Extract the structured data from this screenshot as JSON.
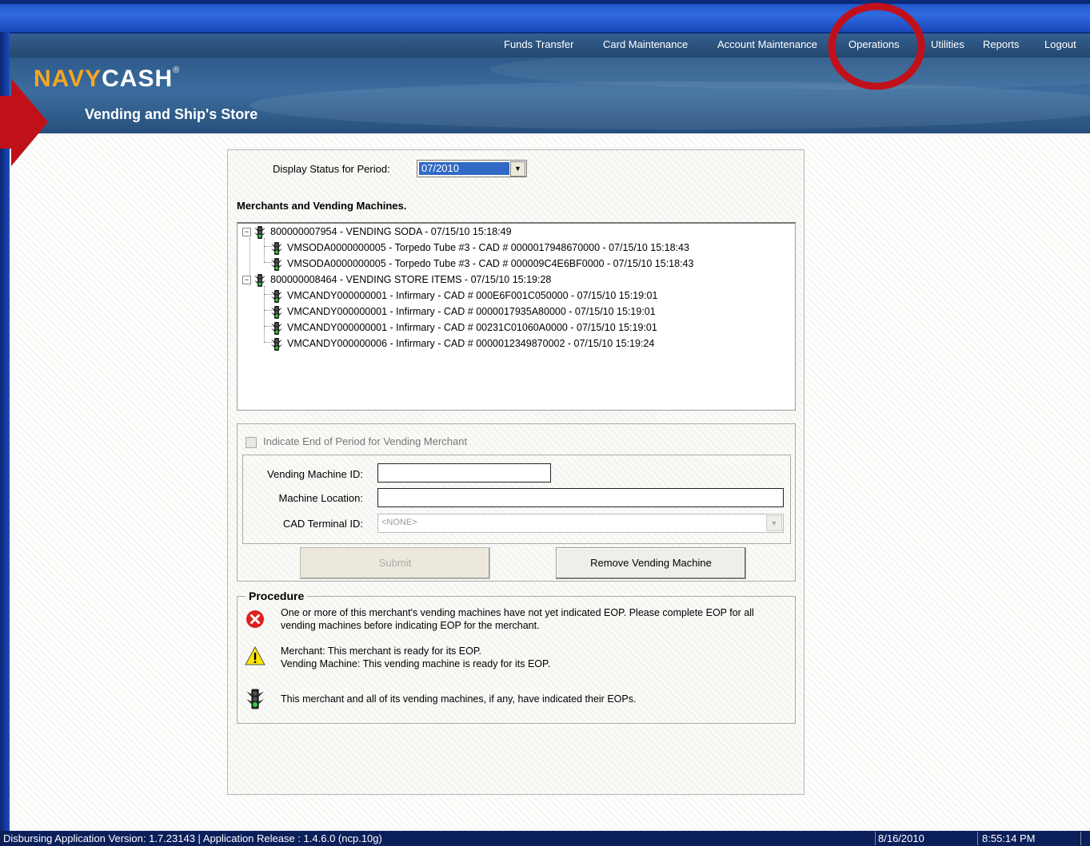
{
  "nav": {
    "items": [
      "Funds Transfer",
      "Card Maintenance",
      "Account Maintenance",
      "Operations",
      "Utilities",
      "Reports",
      "Logout"
    ]
  },
  "banner": {
    "logo_navy": "NAVY",
    "logo_cash": "CASH",
    "logo_reg": "®",
    "subtitle": "Vending and Ship's Store"
  },
  "period": {
    "label": "Display Status for Period:",
    "value": "07/2010"
  },
  "tree": {
    "title": "Merchants and Vending Machines.",
    "rows": [
      "800000007954 - VENDING SODA - 07/15/10 15:18:49",
      "VMSODA0000000005 - Torpedo Tube #3 - CAD # 0000017948670000 - 07/15/10 15:18:43",
      "VMSODA0000000005 - Torpedo Tube #3 - CAD # 000009C4E6BF0000 - 07/15/10 15:18:43",
      "800000008464 - VENDING STORE ITEMS - 07/15/10 15:19:28",
      "VMCANDY000000001 - Infirmary - CAD # 000E6F001C050000 - 07/15/10 15:19:01",
      "VMCANDY000000001 - Infirmary - CAD # 0000017935A80000 - 07/15/10 15:19:01",
      "VMCANDY000000001 - Infirmary - CAD # 00231C01060A0000 - 07/15/10 15:19:01",
      "VMCANDY000000006 - Infirmary - CAD # 0000012349870002 - 07/15/10 15:19:24"
    ]
  },
  "form": {
    "eop_checkbox_label": "Indicate End of Period for Vending Merchant",
    "vm_id_label": "Vending Machine ID:",
    "vm_id_value": "",
    "location_label": "Machine Location:",
    "location_value": "",
    "cad_label": "CAD Terminal ID:",
    "cad_value": "<NONE>",
    "submit_label": "Submit",
    "remove_label": "Remove Vending Machine"
  },
  "procedure": {
    "title": "Procedure",
    "row1": "One or more of this merchant's vending machines have not yet indicated EOP.  Please complete EOP for all vending machines before indicating EOP for the merchant.",
    "row2a": "Merchant: This merchant is ready for its EOP.",
    "row2b": "Vending Machine: This vending machine is ready for its EOP.",
    "row3": "This merchant and all of its vending machines, if any, have indicated their EOPs."
  },
  "status": {
    "version": "Disbursing Application Version:  1.7.23143  | Application Release : 1.4.6.0 (ncp.10g)",
    "date": "8/16/2010",
    "time": "8:55:14 PM"
  },
  "colors": {
    "accent_red": "#c0111b",
    "nav_bg": "#2b5079",
    "selection_blue": "#316ac5"
  }
}
